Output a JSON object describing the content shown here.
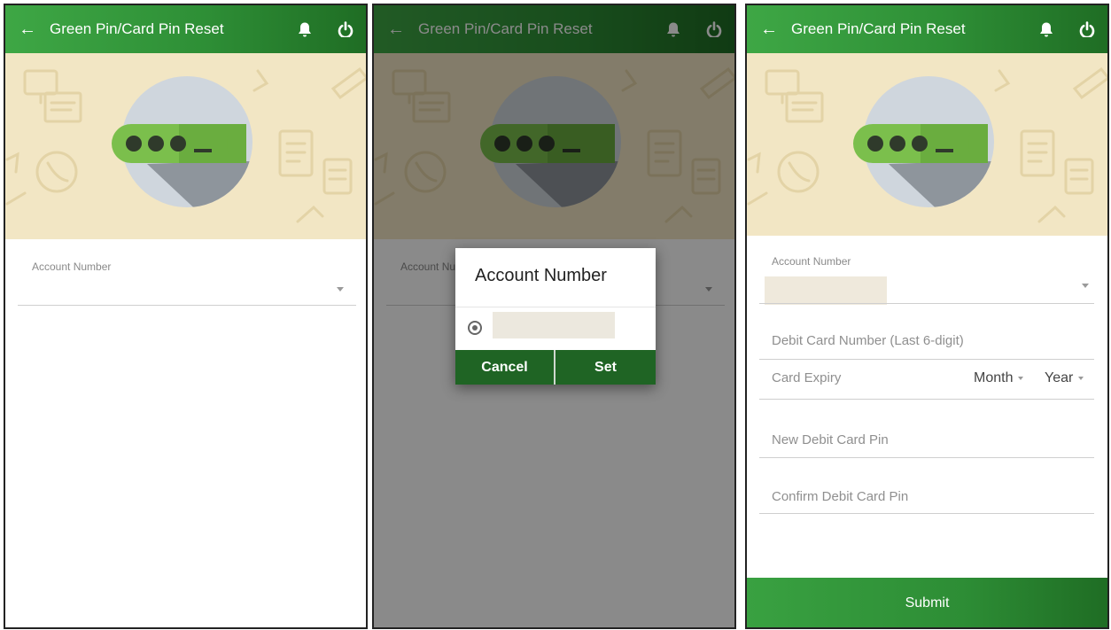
{
  "appbar": {
    "title": "Green Pin/Card Pin Reset",
    "back_icon": "arrow-left-icon",
    "notification_icon": "bell-icon",
    "power_icon": "power-icon"
  },
  "colors": {
    "primary": "#2e8f36",
    "primary_dark": "#1f6424",
    "hero_background": "#f2e6c4",
    "circle": "#cfd6dd",
    "pin_pill": "#7bbf4c"
  },
  "form": {
    "account_label": "Account Number",
    "account_value": "",
    "debit_card_placeholder": "Debit Card Number (Last 6-digit)",
    "card_expiry_label": "Card Expiry",
    "month_label": "Month",
    "year_label": "Year",
    "new_pin_placeholder": "New Debit Card Pin",
    "confirm_pin_placeholder": "Confirm Debit Card Pin",
    "submit_label": "Submit"
  },
  "dialog": {
    "title": "Account Number",
    "option_value": "",
    "cancel_label": "Cancel",
    "set_label": "Set"
  }
}
